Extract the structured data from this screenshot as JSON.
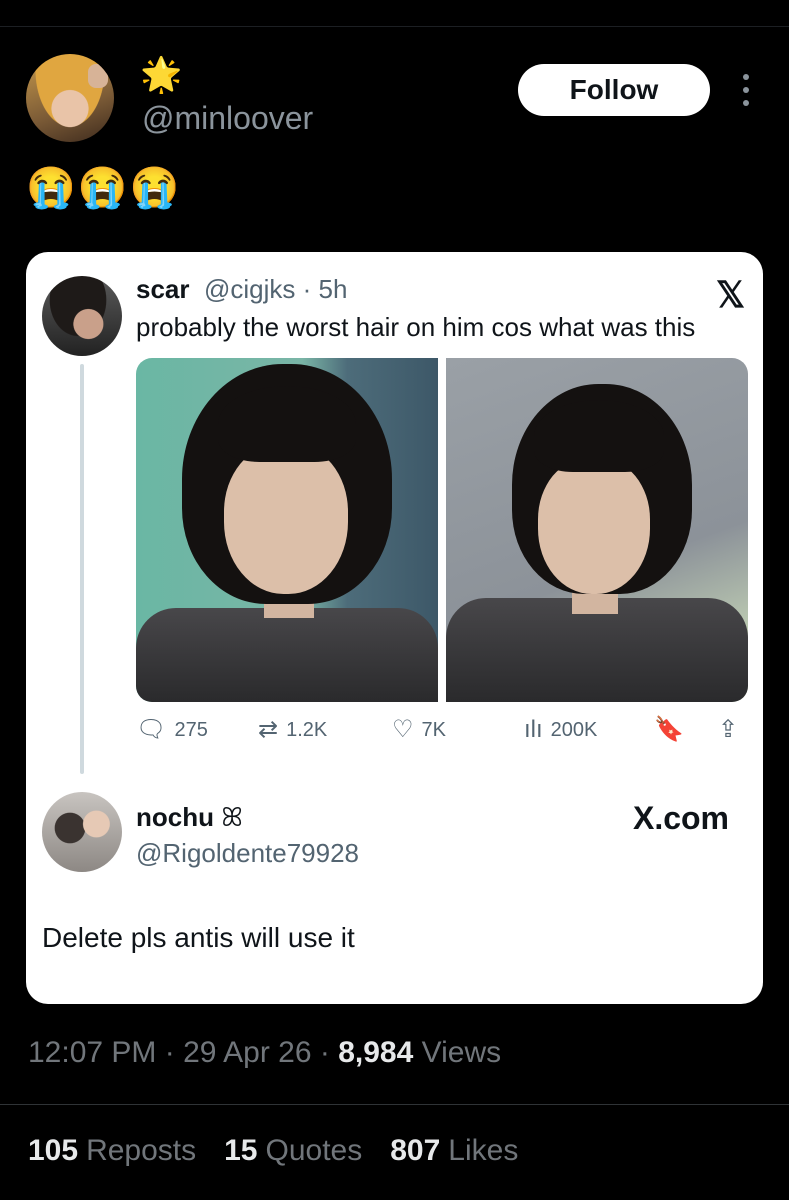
{
  "post": {
    "name_emoji": "🌟",
    "handle": "@minloover",
    "follow_label": "Follow",
    "text": "😭😭😭"
  },
  "quoted": {
    "name": "scar",
    "handle_time": "@cigjks · 5h",
    "text": "probably the worst hair on him cos what was this",
    "platform_icon": "x-logo",
    "stats": {
      "replies": "275",
      "reposts": "1.2K",
      "likes": "7K",
      "views": "200K"
    }
  },
  "reply": {
    "name": "nochu",
    "name_symbol": "ꕤ",
    "handle": "@Rigoldente79928",
    "source": "X.com",
    "text": "Delete pls antis will use it"
  },
  "meta": {
    "time": "12:07 PM",
    "date": "29 Apr 26",
    "views_count": "8,984",
    "views_label": "Views"
  },
  "engagement": {
    "reposts_count": "105",
    "reposts_label": "Reposts",
    "quotes_count": "15",
    "quotes_label": "Quotes",
    "likes_count": "807",
    "likes_label": "Likes"
  }
}
